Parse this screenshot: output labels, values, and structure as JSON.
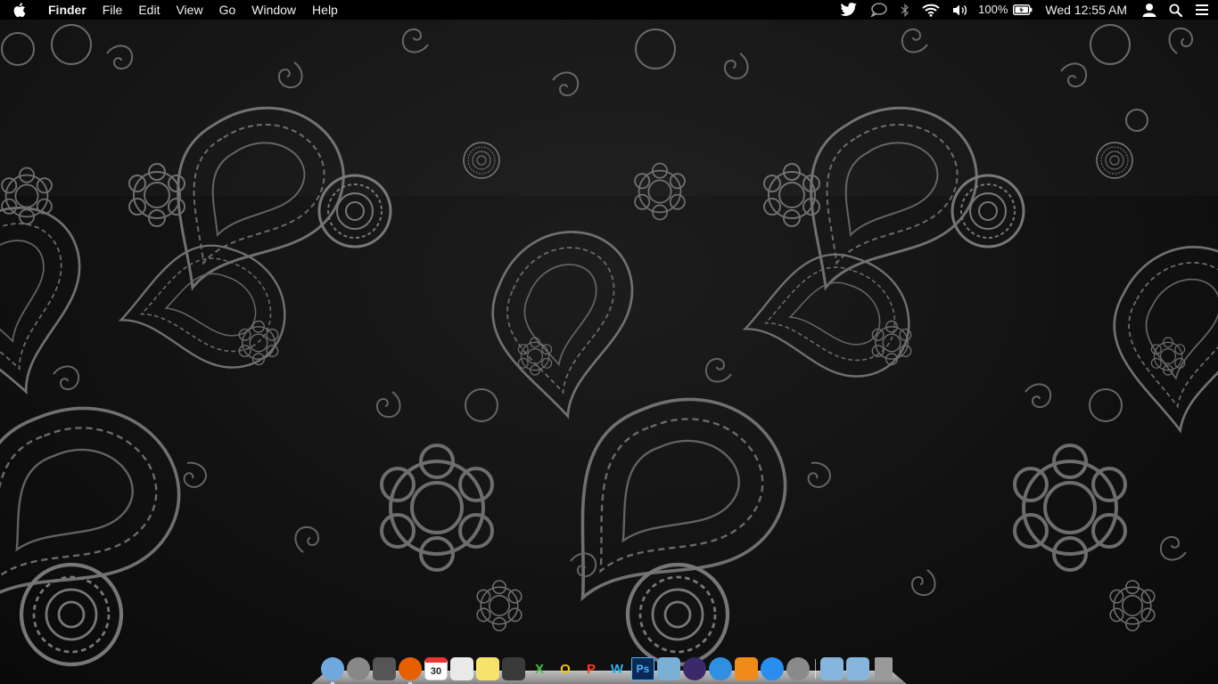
{
  "menubar": {
    "apple_icon": "apple-icon",
    "app_name": "Finder",
    "menus": [
      "File",
      "Edit",
      "View",
      "Go",
      "Window",
      "Help"
    ],
    "status": {
      "icons": [
        "twitter-icon",
        "messages-icon",
        "bluetooth-icon",
        "wifi-icon",
        "volume-icon"
      ],
      "battery_percent": "100%",
      "battery_icon": "battery-charging-icon",
      "clock": "Wed 12:55 AM",
      "user_icon": "user-icon",
      "spotlight_icon": "search-icon",
      "notification_icon": "list-icon"
    }
  },
  "dock": {
    "apps": [
      {
        "name": "finder-icon",
        "label": "",
        "bg": "#6fa8dc"
      },
      {
        "name": "launchpad-icon",
        "label": "",
        "bg": "#888888"
      },
      {
        "name": "mission-control-icon",
        "label": "",
        "bg": "#555555"
      },
      {
        "name": "firefox-icon",
        "label": "",
        "bg": "#e66000"
      },
      {
        "name": "calendar-icon",
        "label": "30",
        "bg": "#ffffff"
      },
      {
        "name": "textedit-icon",
        "label": "",
        "bg": "#e9e9e9"
      },
      {
        "name": "stickies-icon",
        "label": "",
        "bg": "#f7e26b"
      },
      {
        "name": "twitter-app-icon",
        "label": "",
        "bg": "#3a3a3a"
      },
      {
        "name": "excel-icon",
        "label": "X",
        "bg": "transparent",
        "fg": "#3fc43f"
      },
      {
        "name": "outlook-icon",
        "label": "O",
        "bg": "transparent",
        "fg": "#f5c400"
      },
      {
        "name": "powerpoint-icon",
        "label": "P",
        "bg": "transparent",
        "fg": "#ff3b1f"
      },
      {
        "name": "word-icon",
        "label": "W",
        "bg": "transparent",
        "fg": "#2fb4f0"
      },
      {
        "name": "photoshop-icon",
        "label": "Ps",
        "bg": "#0a2a55",
        "fg": "#4fb5ff"
      },
      {
        "name": "preview-icon",
        "label": "",
        "bg": "#7ab0d6"
      },
      {
        "name": "imovie-icon",
        "label": "",
        "bg": "#3b2a6b"
      },
      {
        "name": "itunes-icon",
        "label": "",
        "bg": "#2f8fe0"
      },
      {
        "name": "ibooks-icon",
        "label": "",
        "bg": "#f08a18"
      },
      {
        "name": "app-store-icon",
        "label": "",
        "bg": "#2a8ef0"
      },
      {
        "name": "system-preferences-icon",
        "label": "",
        "bg": "#8a8a8a"
      }
    ],
    "stacks": [
      {
        "name": "applications-folder-icon",
        "bg": "#86b6de"
      },
      {
        "name": "downloads-folder-icon",
        "bg": "#86b6de"
      },
      {
        "name": "trash-icon",
        "bg": "#9a9a9a"
      }
    ]
  }
}
